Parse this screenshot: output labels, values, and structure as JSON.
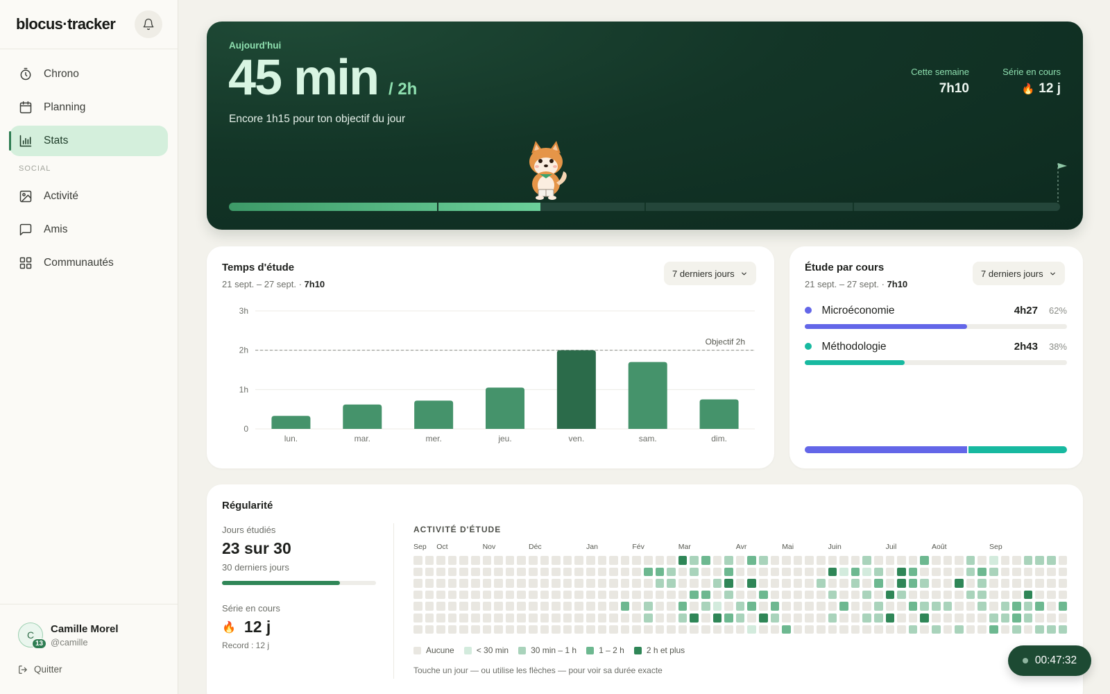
{
  "brand": "blocus·tracker",
  "nav": {
    "items": [
      {
        "label": "Chrono",
        "icon": "stopwatch-icon"
      },
      {
        "label": "Planning",
        "icon": "calendar-icon"
      },
      {
        "label": "Stats",
        "icon": "bar-chart-icon",
        "active": true
      }
    ],
    "section_label": "SOCIAL",
    "social_items": [
      {
        "label": "Activité",
        "icon": "image-icon"
      },
      {
        "label": "Amis",
        "icon": "chat-icon"
      },
      {
        "label": "Communautés",
        "icon": "grid-icon"
      }
    ]
  },
  "user": {
    "initial": "C",
    "level": "13",
    "name": "Camille Morel",
    "handle": "@camille",
    "quit_label": "Quitter"
  },
  "hero": {
    "label": "Aujourd'hui",
    "big_value": "45 min",
    "goal": "/ 2h",
    "subtitle": "Encore 1h15 pour ton objectif du jour",
    "week_label": "Cette semaine",
    "week_value": "7h10",
    "streak_label": "Série en cours",
    "streak_value": "12 j",
    "progress_fraction": 0.375
  },
  "study_time": {
    "title": "Temps d'étude",
    "range": "21 sept. – 27 sept. · ",
    "total": "7h10",
    "period": "7 derniers jours"
  },
  "chart_data": {
    "type": "bar",
    "categories": [
      "lun.",
      "mar.",
      "mer.",
      "jeu.",
      "ven.",
      "sam.",
      "dim."
    ],
    "values": [
      0.33,
      0.62,
      0.72,
      1.05,
      2.0,
      1.7,
      0.75
    ],
    "units": "hours",
    "yticks": [
      "0",
      "1h",
      "1h",
      "2h",
      "3h"
    ],
    "ytick_values": [
      0,
      1,
      2,
      3
    ],
    "ytick_labels": [
      "0",
      "1h",
      "2h",
      "3h"
    ],
    "ylim": [
      0,
      3
    ],
    "goal_value": 2,
    "goal_label": "Objectif 2h",
    "highlight_category": "ven.",
    "grid": true,
    "colors": {
      "bar": "#45936b",
      "highlight": "#2b6b4a",
      "goal_line": "#8d8f89"
    }
  },
  "courses": {
    "title": "Étude par cours",
    "range": "21 sept. – 27 sept. · ",
    "total": "7h10",
    "period": "7 derniers jours",
    "items": [
      {
        "name": "Microéconomie",
        "time": "4h27",
        "pct": "62%",
        "fraction": 0.62,
        "color": "#6366e8"
      },
      {
        "name": "Méthodologie",
        "time": "2h43",
        "pct": "38%",
        "fraction": 0.38,
        "color": "#17b9a0"
      }
    ]
  },
  "regularity": {
    "title": "Régularité",
    "days_label": "Jours étudiés",
    "days_value": "23 sur 30",
    "days_caption": "30 derniers jours",
    "days_fraction": 0.767,
    "streak_label": "Série en cours",
    "streak_value": "12 j",
    "record": "Record : 12 j",
    "activity_title": "ACTIVITÉ D'ÉTUDE",
    "months": [
      "Sep",
      "Oct",
      "Nov",
      "Déc",
      "Jan",
      "Fév",
      "Mar",
      "Avr",
      "Mai",
      "Juin",
      "Juil",
      "Août",
      "Sep"
    ],
    "legend": [
      "Aucune",
      "< 30 min",
      "30 min – 1 h",
      "1 – 2 h",
      "2 h et plus"
    ],
    "level_colors": [
      "#e9e7e1",
      "#d3ebdd",
      "#a9d3bb",
      "#6db890",
      "#2f8657"
    ],
    "hint": "Touche un jour — ou utilise les flèches — pour voir sa durée exacte",
    "heatmap_levels": [
      "000000000000000000000004230203200000000200003000201002220",
      "000000000000000000003320200300000000413120430000232000000",
      "000000000000000000000220002404000002002030432004020000000",
      "000000000000000000000000330200300000200204200000220004000",
      "000000000000000000302003021023030000030020032220020232303",
      "000000000000000000002002404320420000200224004000002232000",
      "000000000000000000000000000001003000000000020202003020222"
    ]
  },
  "timer": "00:47:32"
}
